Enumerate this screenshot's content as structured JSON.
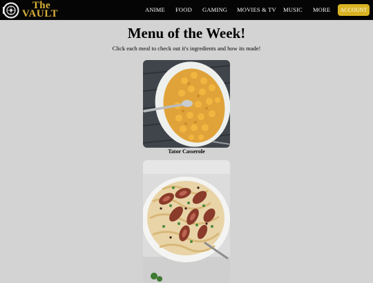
{
  "nav": {
    "logo_line1": "The",
    "logo_line2": "VAULT",
    "items": [
      {
        "label": "ANIME"
      },
      {
        "label": "FOOD"
      },
      {
        "label": "GAMING"
      },
      {
        "label": "MOVIES & TV"
      },
      {
        "label": "MUSIC"
      },
      {
        "label": "MORE"
      }
    ],
    "account_label": "ACCOUNT"
  },
  "main": {
    "title": "Menu of the Week!",
    "subtitle": "Click each meal to check out it's ingredients and how its made!",
    "meals": [
      {
        "name": "Tator Casserole"
      },
      {
        "name": ""
      }
    ]
  },
  "colors": {
    "accent": "#d9b422",
    "navbar": "#050505",
    "background": "#d3d3d3"
  }
}
